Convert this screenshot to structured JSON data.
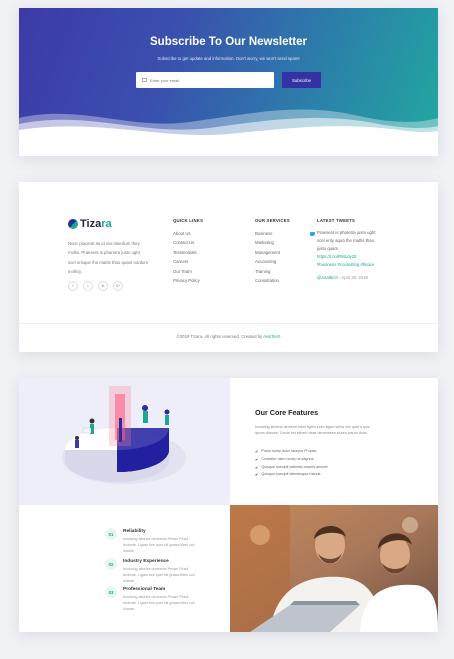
{
  "newsletter": {
    "title": "Subscribe To Our Newsletter",
    "subtitle": "Subscribe to get update and information. Don't worry, we won't send spam!",
    "email_placeholder": "Enter your email",
    "button": "Subscribe"
  },
  "footer": {
    "brand_a": "Tiza",
    "brand_b": "ra",
    "description": "Nunc placerat mi id nisi interdum they mollis. Praesent is pharetra justo ught scel erisque the mattis thao quam nordum mollicy.",
    "social": [
      "f",
      "t",
      "in",
      "G+"
    ],
    "quick_links": {
      "title": "QUICK LINKS",
      "items": [
        "About Us",
        "Contact Us",
        "Testimonials",
        "Careers",
        "Our Team",
        "Privacy Policy"
      ]
    },
    "services": {
      "title": "OUR SERVICES",
      "items": [
        "Business",
        "Marketing",
        "Management",
        "Accounting",
        "Training",
        "Consultation"
      ]
    },
    "tweets": {
      "title": "LATEST TWEETS",
      "text": "Praesent is pharetra justo ught scel erity aqua the mattis thao justo quam",
      "link": "https://t.co/RMLdy20",
      "tags": "#business #consulting #finace",
      "handle": "@Asaltech",
      "date": "- April 29, 2019"
    },
    "copyright": "©2019 Tizara. All rights reserved. Created by",
    "copyright_link": "AssiTech"
  },
  "features": {
    "title": "Our Core Features",
    "description": "Invoicing lamens dementi ment ligam enim ligam velos nisi quet a quis ipsum dimose. Cerde est ellcem dese dermnesse sluora ipsum dolor.",
    "list": [
      "Purus sunty dolor lacepur Pl uptic.",
      "Curabitur olam occep at sagnus.",
      "Quisque suscipit pellentis mauris amoret.",
      "Quisque suscipit ellentesque mauris."
    ],
    "items": [
      {
        "num": "01",
        "title": "Reliability",
        "desc": "Invoicing aitories donemos Pesan Plus4 isolorde. Ligam tice quet sill grawa tiltes cuil lolante."
      },
      {
        "num": "02",
        "title": "Industry Experience",
        "desc": "Invoicing aitories donemos Pesan Plus4 isolorde. Ligam tice quet sill grawa tiltes cuil lolante."
      },
      {
        "num": "03",
        "title": "Professional Team",
        "desc": "Invoicing aitories donemos Pesan Plus4 isolorde. Ligam tice quet sill grawa tiltes cuil lolante."
      }
    ]
  },
  "colors": {
    "brand_blue": "#2a2c9d",
    "brand_teal": "#1fa592"
  }
}
